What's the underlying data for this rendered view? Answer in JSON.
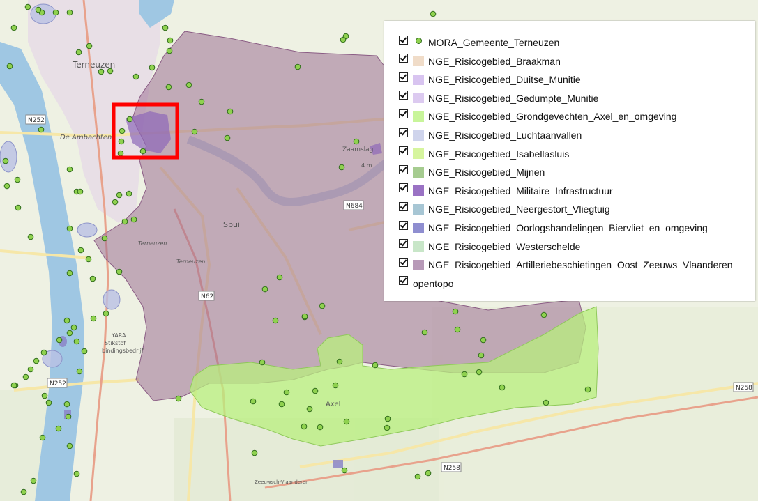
{
  "colors": {
    "braakman": "#f0dcc8",
    "duitse_munitie": "#d8c4f0",
    "gedumpte_munitie": "#dccaf0",
    "grondgevechten": "#c8f59a",
    "luchtaanvallen": "#cfd4ec",
    "isabellasluis": "#d6f59e",
    "mijnen": "#a6cc90",
    "militaire_infrastructuur": "#9a72c4",
    "neergestort_vliegtuig": "#a7c6d4",
    "oorlogshandelingen": "#8f8ed0",
    "westerschelde": "#c8e6c8",
    "artilleriebeschietingen": "#b89ab8",
    "point_fill": "#8fd14f",
    "highlight": "#ff0000"
  },
  "legend": {
    "items": [
      {
        "label": "MORA_Gemeente_Terneuzen",
        "icon": "point-icon"
      },
      {
        "label": "NGE_Risicogebied_Braakman",
        "color": "#f0dcc8"
      },
      {
        "label": "NGE_Risicogebied_Duitse_Munitie",
        "color": "#d8c4f0"
      },
      {
        "label": "NGE_Risicogebied_Gedumpte_Munitie",
        "color": "#dccaf0"
      },
      {
        "label": "NGE_Risicogebied_Grondgevechten_Axel_en_omgeving",
        "color": "#c8f59a"
      },
      {
        "label": "NGE_Risicogebied_Luchtaanvallen",
        "color": "#cfd4ec"
      },
      {
        "label": "NGE_Risicogebied_Isabellasluis",
        "color": "#d6f59e"
      },
      {
        "label": "NGE_Risicogebied_Mijnen",
        "color": "#a6cc90"
      },
      {
        "label": "NGE_Risicogebied_Militaire_Infrastructuur",
        "color": "#9a72c4"
      },
      {
        "label": "NGE_Risicogebied_Neergestort_Vliegtuig",
        "color": "#a7c6d4"
      },
      {
        "label": "NGE_Risicogebied_Oorlogshandelingen_Biervliet_en_omgeving",
        "color": "#8f8ed0"
      },
      {
        "label": "NGE_Risicogebied_Westerschelde",
        "color": "#c8e6c8"
      },
      {
        "label": "NGE_Risicogebied_Artilleriebeschietingen_Oost_Zeeuws_Vlaanderen",
        "color": "#b89ab8"
      },
      {
        "label": "opentopo",
        "icon": "none"
      }
    ]
  },
  "map_labels": {
    "terneuzen": "Terneuzen",
    "de_ambachten": "De Ambachten",
    "zaamslag": "Zaamslag",
    "spui": "Spui",
    "axel": "Axel",
    "n252_a": "N252",
    "n252_b": "N252",
    "n62": "N62",
    "n684": "N684",
    "n258_a": "N258",
    "n258_b": "N258",
    "yara": "YARA",
    "stikstof": "Stikstof",
    "bindingsbedrijf": "bindingsbedrijf",
    "zeeuwsche": "Zeeuwsch-Vlaanderen",
    "four_m": "4 m",
    "terneuzen_small": "Terneuzen",
    "terneuzen_canal": "Terneuzen"
  }
}
